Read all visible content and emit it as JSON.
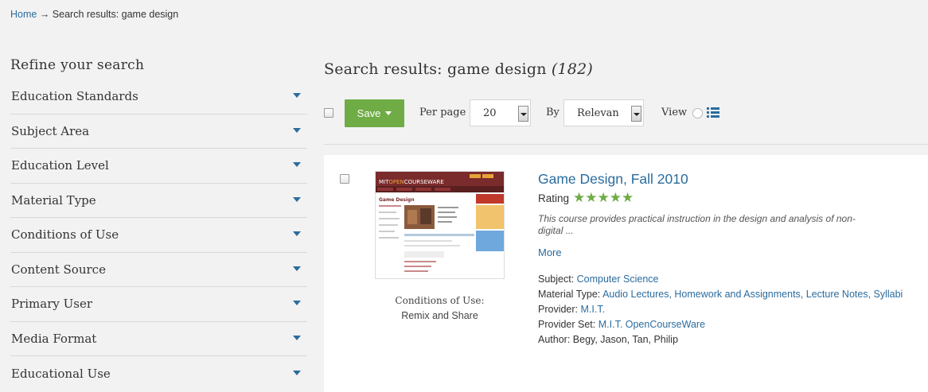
{
  "breadcrumb": {
    "home": "Home",
    "arrow": " → ",
    "current": "Search results: game design"
  },
  "sidebar": {
    "title": "Refine your search",
    "facets": [
      "Education Standards",
      "Subject Area",
      "Education Level",
      "Material Type",
      "Conditions of Use",
      "Content Source",
      "Primary User",
      "Media Format",
      "Educational Use"
    ]
  },
  "results": {
    "title": "Search results: game design",
    "count": "(182)"
  },
  "toolbar": {
    "save_label": "Save",
    "per_page_label": "Per page",
    "per_page_value": "20",
    "sort_label": "By",
    "sort_value": "Relevan",
    "view_label": "View"
  },
  "result": {
    "title": "Game Design, Fall 2010",
    "rating_label": "Rating",
    "stars": "★★★★★",
    "rating_value": 5,
    "description": "This course provides practical instruction in the design and analysis of non-digital ...",
    "more": "More",
    "conditions_label": "Conditions of Use:",
    "conditions_value": "Remix and Share",
    "subject_label": "Subject: ",
    "subject": "Computer Science",
    "material_label": "Material Type: ",
    "material": "Audio Lectures, Homework and Assignments, Lecture Notes, Syllabi",
    "provider_label": "Provider: ",
    "provider": "M.I.T.",
    "provider_set_label": "Provider Set: ",
    "provider_set": "M.I.T. OpenCourseWare",
    "author_label": "Author: ",
    "author": "Begy, Jason, Tan, Philip",
    "thumb": {
      "brand_prefix": "MIT",
      "brand_accent": "OPEN",
      "brand_suffix": "COURSEWARE",
      "page_title": "Game Design"
    }
  },
  "colors": {
    "link": "#2b6c9e",
    "save": "#6fac46",
    "stars": "#6fac46",
    "background": "#f2f2f2"
  }
}
